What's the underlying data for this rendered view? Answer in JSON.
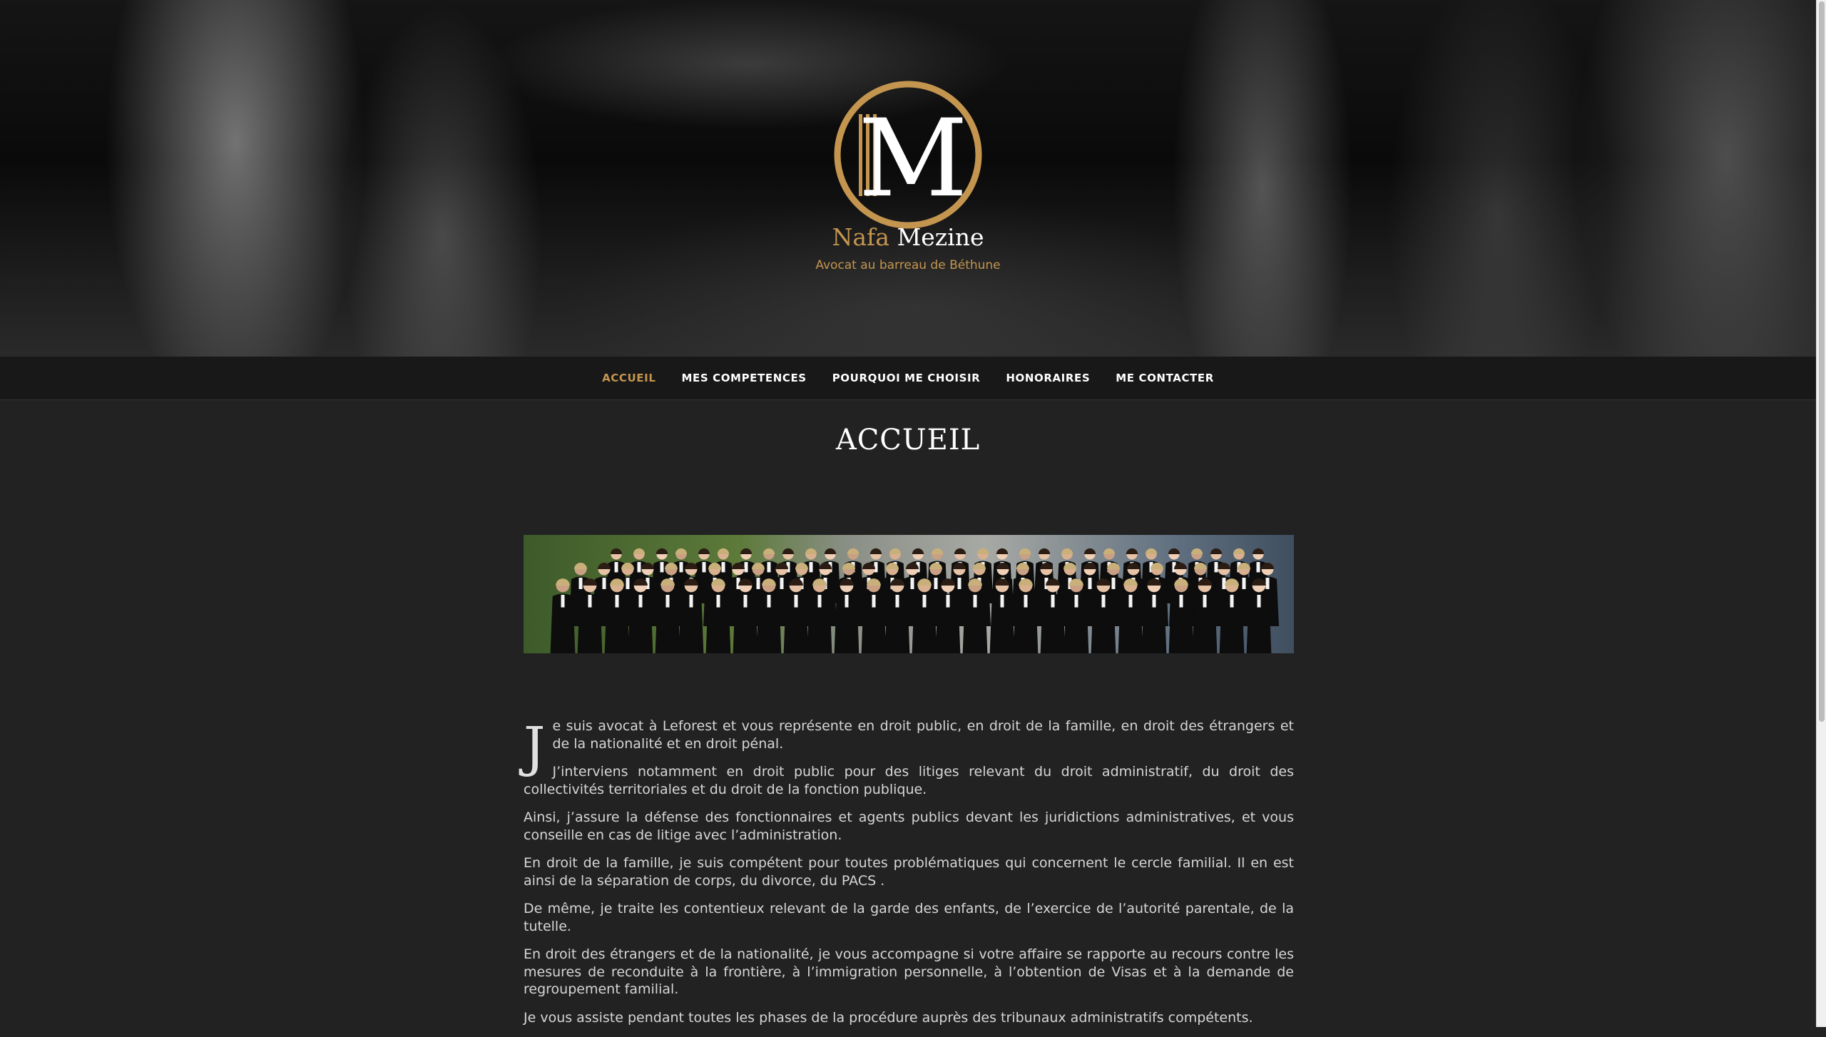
{
  "brand": {
    "logo_letter": "M",
    "first_name": "Nafa",
    "last_name": "Mezine",
    "tagline": "Avocat au barreau de Béthune",
    "accent_color": "#c4954f"
  },
  "nav": {
    "items": [
      {
        "label": "ACCUEIL",
        "active": true
      },
      {
        "label": "MES COMPETENCES",
        "active": false
      },
      {
        "label": "POURQUOI ME CHOISIR",
        "active": false
      },
      {
        "label": "HONORAIRES",
        "active": false
      },
      {
        "label": "ME CONTACTER",
        "active": false
      }
    ]
  },
  "page": {
    "title": "ACCUEIL"
  },
  "content": {
    "dropcap": "J",
    "first_paragraph": "e suis avocat à Leforest et vous représente en droit public, en droit de la famille, en droit des étrangers et de la nationalité et en droit pénal.",
    "paragraphs": [
      "J’interviens notamment en droit public pour des litiges relevant du droit administratif, du droit des collectivités territoriales et du droit de la fonction publique.",
      "Ainsi, j’assure la défense des fonctionnaires et agents publics devant les juridictions administratives, et vous conseille en cas de litige avec l’administration.",
      "En droit de la famille, je suis compétent pour toutes problématiques qui concernent le cercle familial. Il en est ainsi de la séparation de corps, du divorce, du PACS .",
      "De même, je traite les contentieux relevant de la garde des enfants, de l’exercice de l’autorité parentale, de la tutelle.",
      "En droit des étrangers et de la nationalité, je vous accompagne si votre affaire se rapporte au recours contre les mesures de reconduite à la frontière, à l’immigration personnelle, à l’obtention de Visas et à la demande de regroupement familial.",
      "Je vous assiste pendant toutes les phases de la procédure auprès des tribunaux administratifs compétents."
    ]
  }
}
